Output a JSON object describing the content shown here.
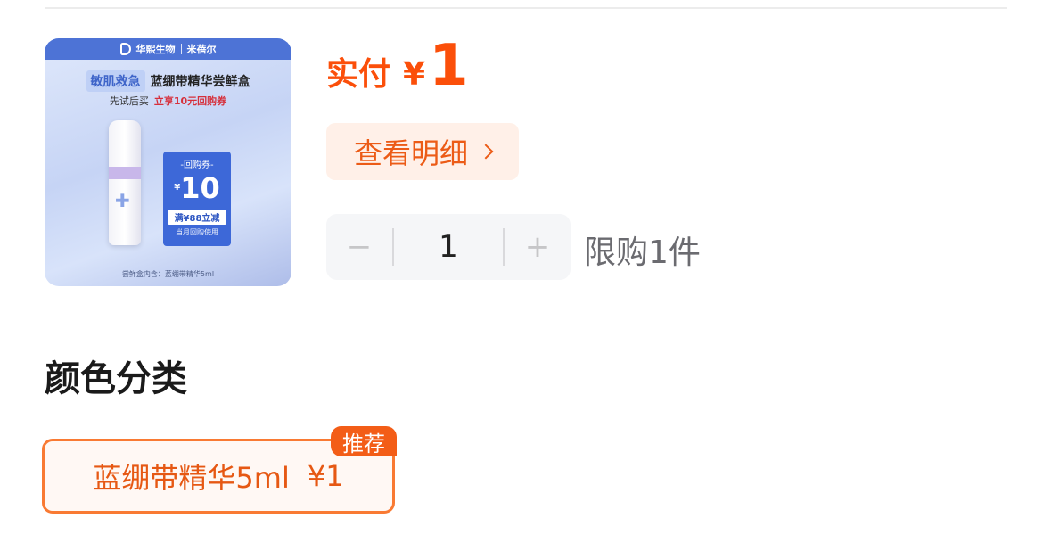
{
  "product": {
    "image": {
      "brand_left": "华熙生物",
      "brand_right": "米蓓尔",
      "badge": "敏肌救急",
      "title": "蓝绷带精华尝鲜盒",
      "sub_left": "先试后买",
      "sub_right": "立享10元回购券",
      "coupon_title": "-回购券-",
      "coupon_symbol": "¥",
      "coupon_value": "10",
      "coupon_condition": "满¥88立减",
      "coupon_note": "当月回购使用",
      "footer": "尝鲜盒内含：蓝绷带精华5ml"
    },
    "price_label": "实付",
    "price_symbol": "¥",
    "price_value": "1",
    "detail_button": "查看明细"
  },
  "quantity": {
    "minus": "−",
    "value": "1",
    "plus": "+",
    "limit": "限购1件"
  },
  "variants": {
    "title": "颜色分类",
    "options": [
      {
        "label": "蓝绷带精华5ml",
        "price": "¥1",
        "tag": "推荐"
      }
    ]
  },
  "colors": {
    "accent": "#fb4f0a",
    "button_bg": "#fff0e8"
  },
  "icons": [
    "chevron-right-icon",
    "minus-icon",
    "plus-icon"
  ]
}
